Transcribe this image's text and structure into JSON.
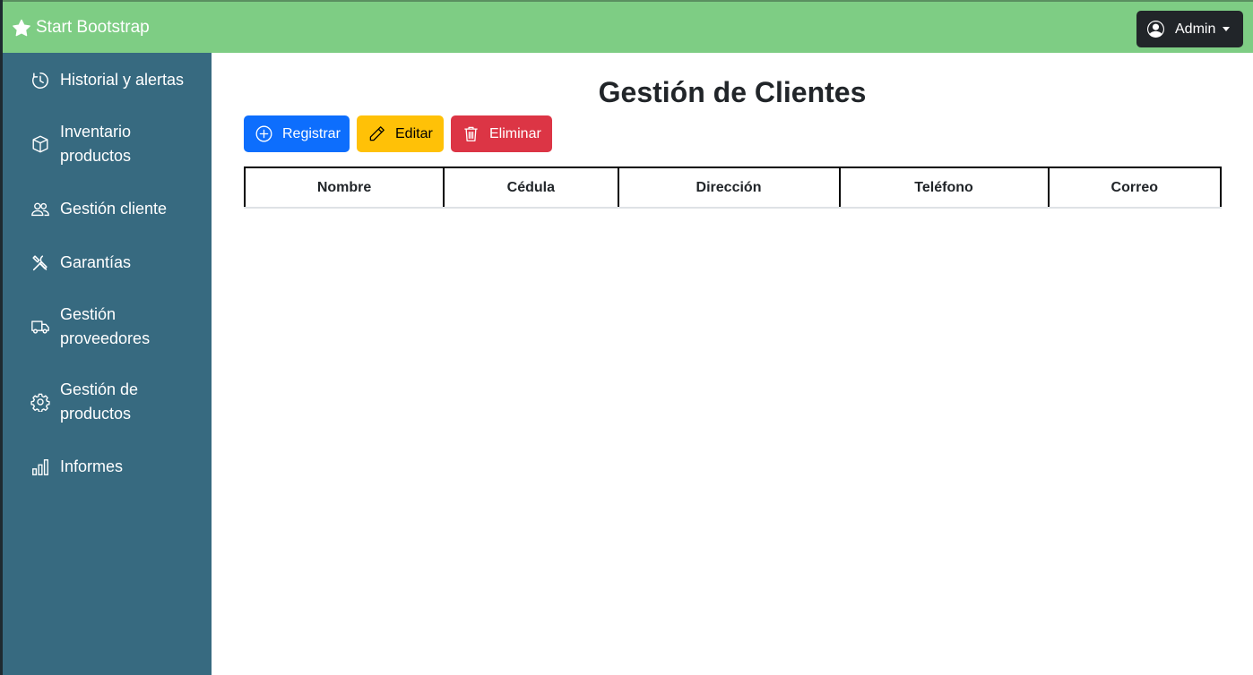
{
  "brand": {
    "label": "Start Bootstrap",
    "icon": "star-icon"
  },
  "user_menu": {
    "label": "Admin",
    "icon": "user-circle-icon"
  },
  "sidebar": {
    "items": [
      {
        "label": "Historial y alertas",
        "icon": "clock-history-icon"
      },
      {
        "label": "Inventario productos",
        "icon": "box-icon"
      },
      {
        "label": "Gestión cliente",
        "icon": "people-icon"
      },
      {
        "label": "Garantías",
        "icon": "tools-icon"
      },
      {
        "label": "Gestión proveedores",
        "icon": "truck-icon"
      },
      {
        "label": "Gestión de productos",
        "icon": "gear-icon"
      },
      {
        "label": "Informes",
        "icon": "bar-chart-icon"
      }
    ]
  },
  "main": {
    "title": "Gestión de Clientes",
    "actions": {
      "register": "Registrar",
      "edit": "Editar",
      "delete": "Eliminar"
    },
    "table": {
      "columns": [
        "Nombre",
        "Cédula",
        "Dirección",
        "Teléfono",
        "Correo"
      ],
      "rows": []
    }
  },
  "colors": {
    "topbar": "#7ecd84",
    "sidebar": "#376a80",
    "primary": "#0d6efd",
    "warning": "#ffc107",
    "danger": "#dc3545",
    "dark": "#212529"
  }
}
